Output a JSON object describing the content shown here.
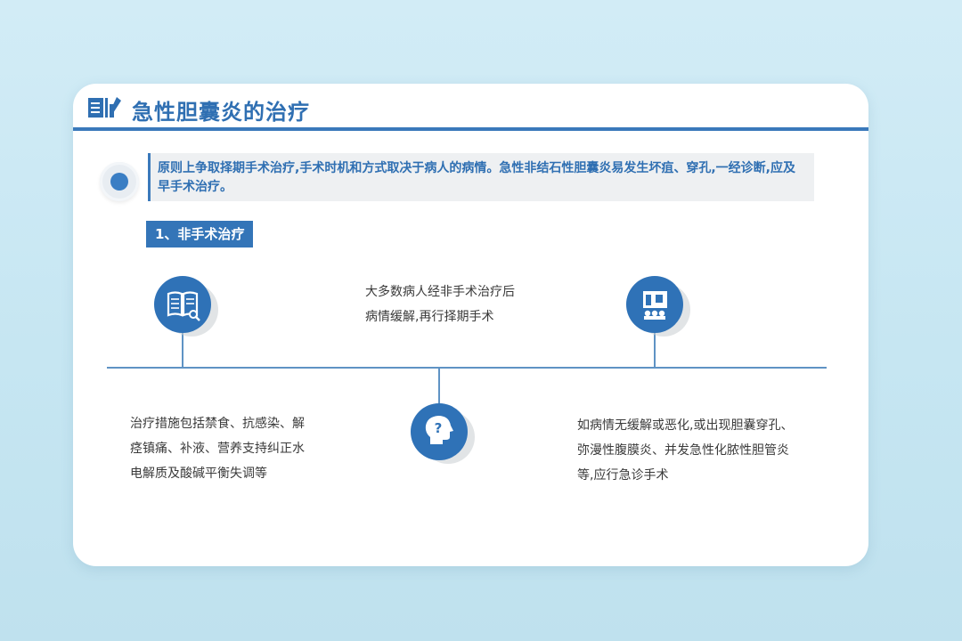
{
  "header": {
    "title": "急性胆囊炎的治疗",
    "icon": "book-edit-icon"
  },
  "intro": {
    "text": "原则上争取择期手术治疗,手术时机和方式取决于病人的病情。急性非结石性胆囊炎易发生坏疽、穿孔,一经诊断,应及早手术治疗。"
  },
  "section": {
    "label": "1、非手术治疗"
  },
  "nodes": [
    {
      "icon": "book-search-icon"
    },
    {
      "icon": "head-question-icon"
    },
    {
      "icon": "presentation-board-icon"
    }
  ],
  "texts": {
    "top_center": [
      "大多数病人经非手术治疗后",
      "病情缓解,再行择期手术"
    ],
    "bottom_left": [
      "治疗措施包括禁食、抗感染、解",
      "痉镇痛、补液、营养支持纠正水",
      "电解质及酸碱平衡失调等"
    ],
    "bottom_right": [
      "如病情无缓解或恶化,或出现胆囊穿孔、",
      "弥漫性腹膜炎、并发急性化脓性胆管炎",
      "等,应行急诊手术"
    ]
  },
  "colors": {
    "primary": "#2f72b7",
    "title": "#2f6fb2",
    "intro_bg": "#eef0f2"
  }
}
